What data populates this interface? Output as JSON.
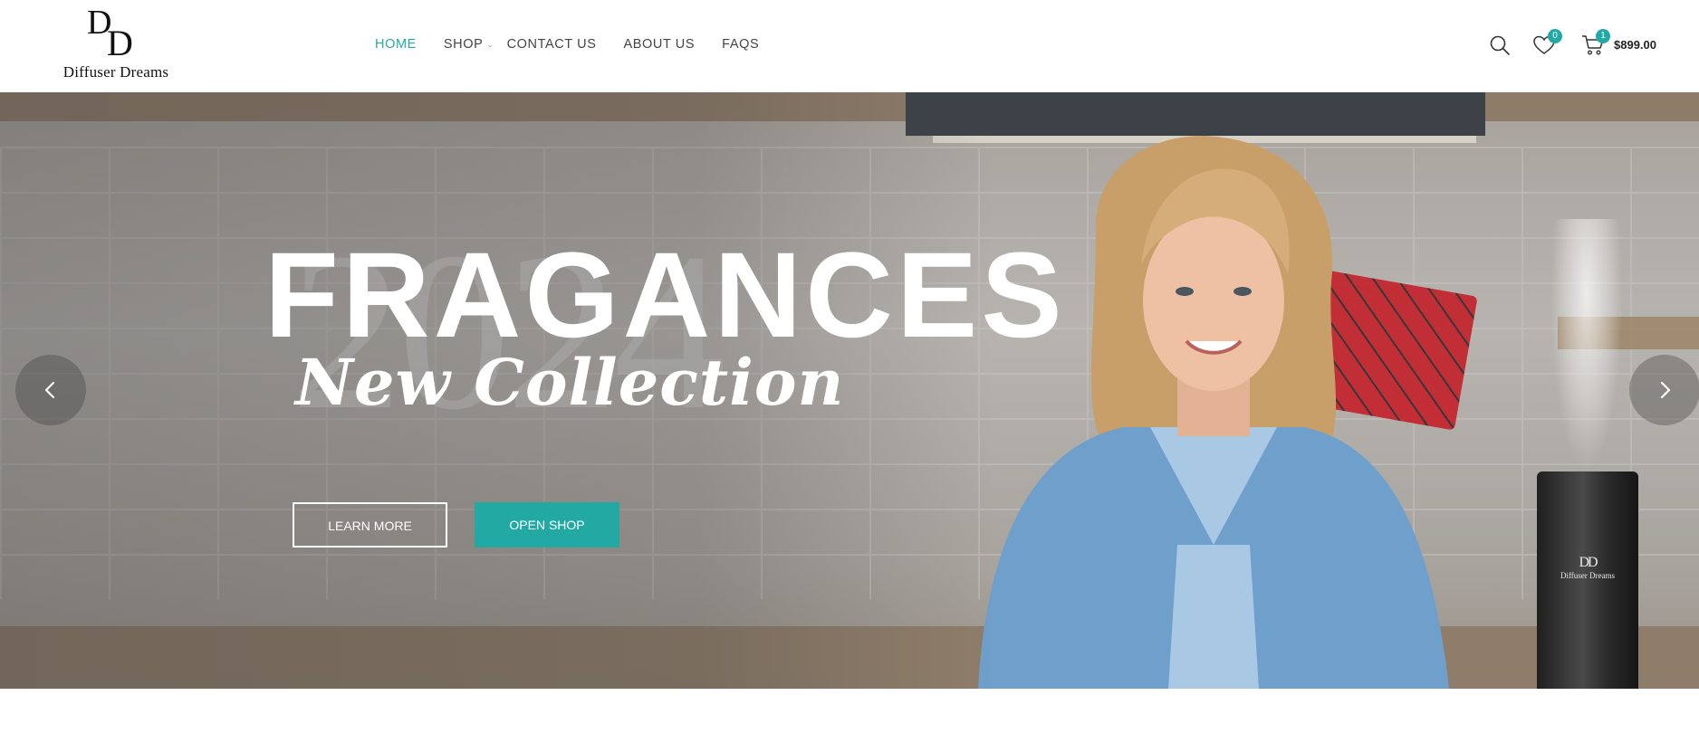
{
  "brand": {
    "logo_mark": "DD",
    "logo_text": "Diffuser Dreams"
  },
  "nav": {
    "items": [
      {
        "label": "HOME",
        "active": true
      },
      {
        "label": "SHOP",
        "has_dropdown": true
      },
      {
        "label": "CONTACT US"
      },
      {
        "label": "ABOUT US"
      },
      {
        "label": "FAQS"
      }
    ]
  },
  "header": {
    "wishlist_count": "0",
    "cart_count": "1",
    "cart_total": "$899.00",
    "icons": [
      "search-icon",
      "heart-icon",
      "cart-icon"
    ]
  },
  "hero": {
    "background_year": "2024",
    "title": "FRAGANCES",
    "subtitle": "New Collection",
    "learn_more_label": "LEARN MORE",
    "open_shop_label": "OPEN SHOP",
    "product_logo_mark": "DD",
    "product_logo_text": "Diffuser Dreams"
  },
  "colors": {
    "accent": "#23a9a3",
    "text": "#444444",
    "white": "#ffffff"
  }
}
